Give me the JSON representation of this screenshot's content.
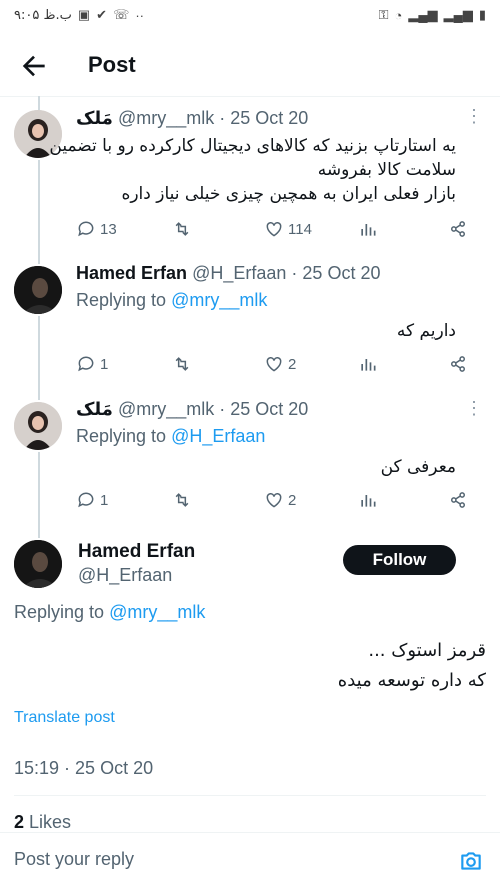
{
  "status_bar": {
    "time": "۹:۰۵ ب.ظ",
    "dots": "··"
  },
  "header": {
    "title": "Post"
  },
  "tweets": [
    {
      "name": "مَلک",
      "handle": "@mry__mlk",
      "date": "25 Oct 20",
      "text_lines": [
        "یه استارتاپ بزنید که کالاهای دیجیتال کارکرده رو با تضمین",
        "سلامت کالا بفروشه",
        "بازار فعلی ایران به همچین چیزی خیلی نیاز داره"
      ],
      "replies": "13",
      "retweets": "",
      "likes": "114"
    },
    {
      "name": "Hamed Erfan",
      "handle": "@H_Erfaan",
      "date": "25 Oct 20",
      "replying_label": "Replying to",
      "replying_to": "@mry__mlk",
      "text": "داریم که",
      "replies": "1",
      "likes": "2"
    },
    {
      "name": "مَلک",
      "handle": "@mry__mlk",
      "date": "25 Oct 20",
      "replying_label": "Replying to",
      "replying_to": "@H_Erfaan",
      "text": "معرفی کن",
      "replies": "1",
      "likes": "2"
    }
  ],
  "main_tweet": {
    "name": "Hamed Erfan",
    "handle": "@H_Erfaan",
    "follow_label": "Follow",
    "replying_label": "Replying to",
    "replying_to": "@mry__mlk",
    "text_lines": [
      "قرمز استوک ...",
      "که داره توسعه میده"
    ],
    "translate_label": "Translate post",
    "timestamp": "15:19 · 25 Oct 20",
    "likes_count": "2",
    "likes_label": "Likes"
  },
  "reply_bar": {
    "placeholder": "Post your reply"
  },
  "colors": {
    "accent": "#1d9bf0",
    "text": "#0f1419",
    "muted": "#536471"
  }
}
